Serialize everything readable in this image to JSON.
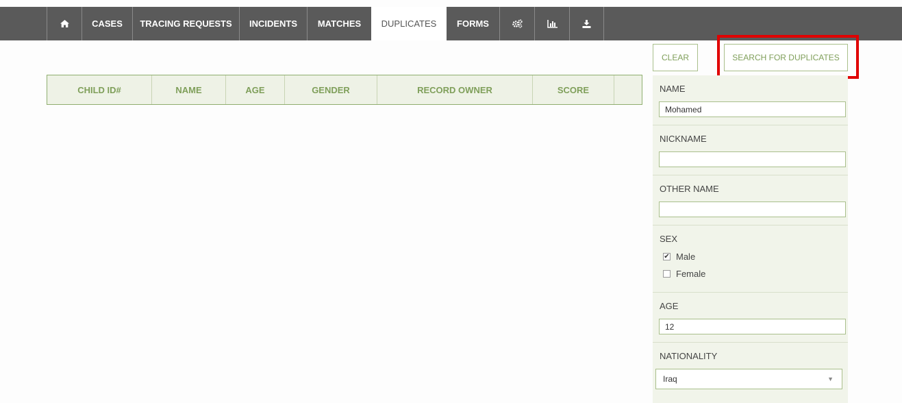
{
  "nav": {
    "items": [
      {
        "label": "",
        "icon": "home-icon"
      },
      {
        "label": "CASES"
      },
      {
        "label": "TRACING REQUESTS"
      },
      {
        "label": "INCIDENTS"
      },
      {
        "label": "MATCHES"
      },
      {
        "label": "DUPLICATES",
        "active": true
      },
      {
        "label": "FORMS"
      },
      {
        "label": "",
        "icon": "gears-icon"
      },
      {
        "label": "",
        "icon": "bar-chart-icon"
      },
      {
        "label": "",
        "icon": "download-icon"
      }
    ]
  },
  "table": {
    "columns": [
      "CHILD ID#",
      "NAME",
      "AGE",
      "GENDER",
      "RECORD OWNER",
      "SCORE",
      ""
    ]
  },
  "actions": {
    "clear_label": "CLEAR",
    "search_label": "SEARCH FOR DUPLICATES"
  },
  "filters": {
    "name": {
      "label": "NAME",
      "value": "Mohamed"
    },
    "nickname": {
      "label": "NICKNAME",
      "value": ""
    },
    "other_name": {
      "label": "OTHER NAME",
      "value": ""
    },
    "sex": {
      "label": "SEX",
      "options": [
        {
          "label": "Male",
          "checked": true
        },
        {
          "label": "Female",
          "checked": false
        }
      ]
    },
    "age": {
      "label": "AGE",
      "value": "12"
    },
    "nationality": {
      "label": "NATIONALITY",
      "value": "Iraq"
    }
  },
  "colors": {
    "navbar": "#5a5a5a",
    "accent": "#7f9f5a",
    "highlight": "#e00000"
  }
}
